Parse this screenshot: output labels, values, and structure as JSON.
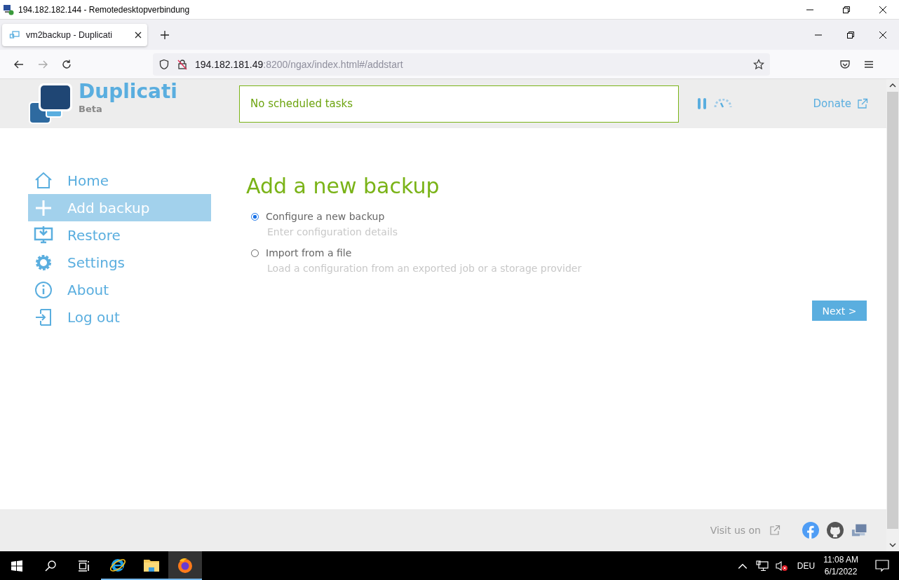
{
  "remote_window": {
    "title": "194.182.182.144 - Remotedesktopverbindung"
  },
  "browser": {
    "tab": {
      "title": "vm2backup - Duplicati",
      "selected": true
    },
    "url": {
      "host": "194.182.181.49",
      "rest": ":8200/ngax/index.html#/addstart"
    }
  },
  "header": {
    "logo_title": "Duplicati",
    "logo_subtitle": "Beta",
    "status": "No scheduled tasks",
    "donate": "Donate"
  },
  "sidebar": {
    "items": [
      {
        "kind": "home",
        "label": "Home",
        "selected": false
      },
      {
        "kind": "add",
        "label": "Add backup",
        "selected": true
      },
      {
        "kind": "restore",
        "label": "Restore",
        "selected": false
      },
      {
        "kind": "settings",
        "label": "Settings",
        "selected": false
      },
      {
        "kind": "about",
        "label": "About",
        "selected": false
      },
      {
        "kind": "logout",
        "label": "Log out",
        "selected": false
      }
    ]
  },
  "main": {
    "heading": "Add a new backup",
    "options": [
      {
        "label": "Configure a new backup",
        "description": "Enter configuration details",
        "selected": true
      },
      {
        "label": "Import from a file",
        "description": "Load a configuration from an exported job or a storage provider",
        "selected": false
      }
    ],
    "next_button": "Next >"
  },
  "footer": {
    "visit": "Visit us on"
  },
  "taskbar": {
    "apps": [
      {
        "kind": "ie",
        "running": true,
        "selected": false
      },
      {
        "kind": "explorer",
        "running": true,
        "selected": false
      },
      {
        "kind": "firefox",
        "running": true,
        "selected": true
      }
    ],
    "language": "DEU",
    "time": "11:08 AM",
    "date": "6/1/2022"
  }
}
